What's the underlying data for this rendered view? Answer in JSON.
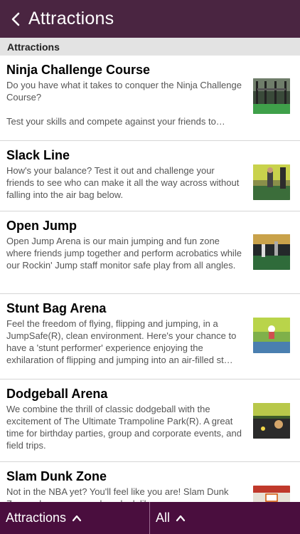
{
  "navbar": {
    "back_icon": "chevron-left-icon",
    "title": "Attractions"
  },
  "section": {
    "label": "Attractions"
  },
  "items": [
    {
      "title": "Ninja Challenge Course",
      "description": "Do you have what it takes to conquer the Ninja Challenge Course?\n\nTest your skills and compete against your friends to…"
    },
    {
      "title": "Slack Line",
      "description": "How's your balance? Test it out and challenge your friends to see who can make it all the way across without falling into the air bag below."
    },
    {
      "title": "Open Jump",
      "description": "Open Jump Arena is our main jumping and fun zone where friends jump together and perform acrobatics while our Rockin' Jump staff monitor safe play from all angles."
    },
    {
      "title": "Stunt Bag Arena",
      "description": "Feel the freedom of flying, flipping and jumping, in a JumpSafe(R), clean environment. Here's your chance to have a 'stunt performer' experience enjoying the exhilaration of flipping and jumping into an air-filled st…"
    },
    {
      "title": "Dodgeball Arena",
      "description": "We combine the thrill of classic dodgeball with the excitement of The Ultimate Trampoline Park(R). A great time for birthday parties, group and corporate events, and field trips."
    },
    {
      "title": "Slam Dunk Zone",
      "description": "Not in the NBA yet? You'll feel like you are! Slam Dunk Zone, where you can slam dunk like a pro on"
    }
  ],
  "tabbar": {
    "left_label": "Attractions",
    "right_label": "All",
    "chevron_icon": "chevron-up-icon"
  },
  "colors": {
    "navbar": "#4a2541",
    "tabbar": "#4a0e3e"
  }
}
